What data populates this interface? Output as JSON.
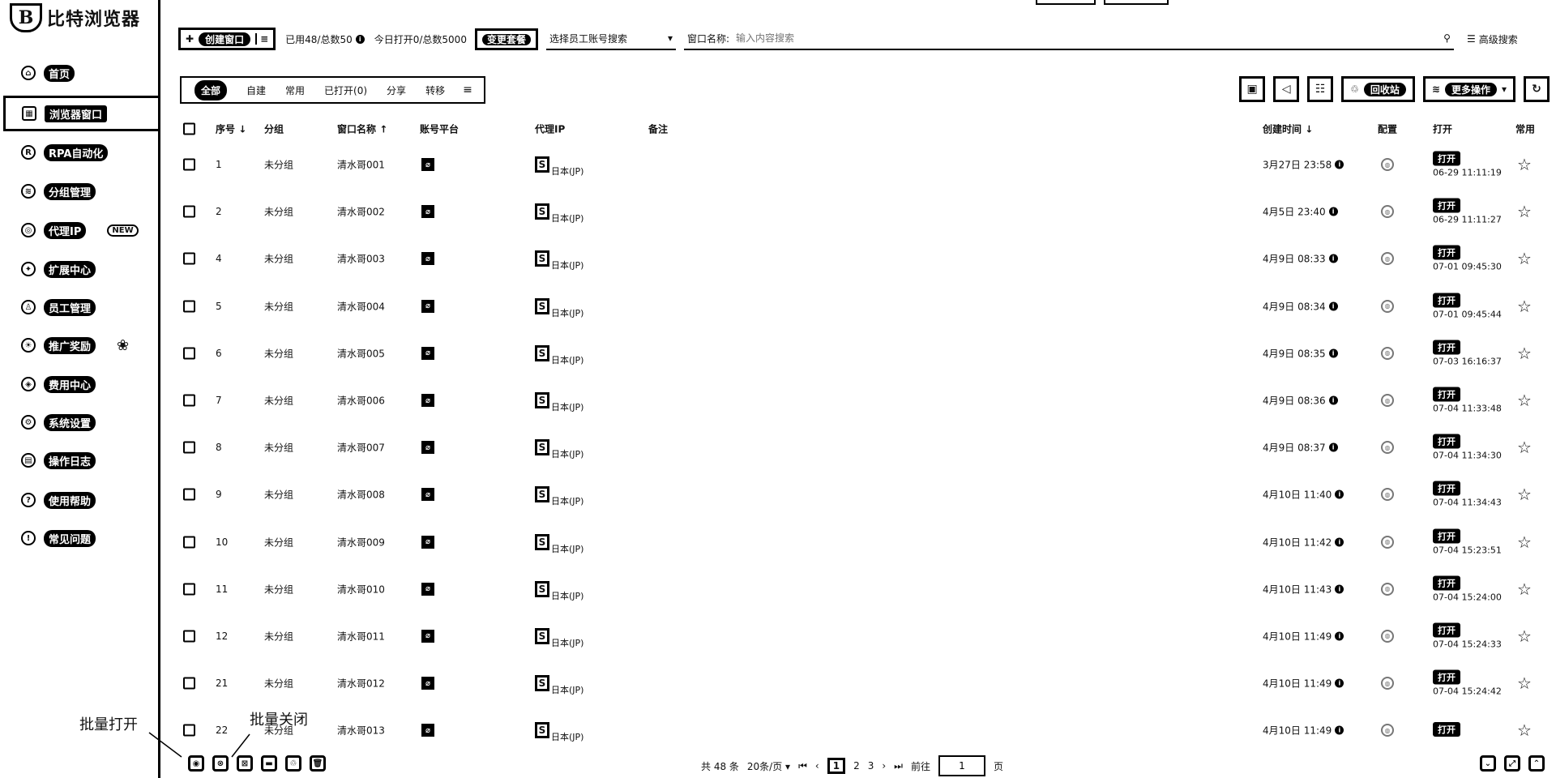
{
  "app": {
    "logo_mark": "B",
    "name": "比特浏览器"
  },
  "sidebar": {
    "items": [
      {
        "label": "首页",
        "icon": "home-icon",
        "glyph": "⌂"
      },
      {
        "label": "浏览器窗口",
        "icon": "window-grid-icon",
        "glyph": "▦"
      },
      {
        "label": "RPA自动化",
        "icon": "robot-icon",
        "glyph": "R"
      },
      {
        "label": "分组管理",
        "icon": "layers-icon",
        "glyph": "≋"
      },
      {
        "label": "代理IP",
        "icon": "location-pin-icon",
        "glyph": "◎",
        "badge": "NEW"
      },
      {
        "label": "扩展中心",
        "icon": "puzzle-icon",
        "glyph": "✦"
      },
      {
        "label": "员工管理",
        "icon": "users-icon",
        "glyph": "♙"
      },
      {
        "label": "推广奖励",
        "icon": "bulb-icon",
        "glyph": "☀",
        "extra_icon": "gift-icon"
      },
      {
        "label": "费用中心",
        "icon": "shield-icon",
        "glyph": "◈"
      },
      {
        "label": "系统设置",
        "icon": "gear-icon",
        "glyph": "⚙"
      },
      {
        "label": "操作日志",
        "icon": "log-icon",
        "glyph": "▤"
      },
      {
        "label": "使用帮助",
        "icon": "help-icon",
        "glyph": "?"
      },
      {
        "label": "常见问题",
        "icon": "info-icon",
        "glyph": "!"
      }
    ]
  },
  "toolbar": {
    "create_label": "创建窗口",
    "quota_used": "已用48/总数50",
    "quota_open": "今日打开0/总数5000",
    "change_plan": "变更套餐",
    "staff_placeholder": "选择员工账号搜索",
    "window_name_label": "窗口名称:",
    "window_name_placeholder": "输入内容搜索",
    "advanced_search": "高级搜索"
  },
  "filter_tabs": [
    "全部",
    "自建",
    "常用",
    "已打开(0)",
    "分享",
    "转移"
  ],
  "actions": {
    "recycle": "回收站",
    "more": "更多操作"
  },
  "table": {
    "headers": {
      "index": "序号",
      "group": "分组",
      "name": "窗口名称",
      "platform": "账号平台",
      "proxy": "代理IP",
      "remark": "备注",
      "created": "创建时间",
      "config": "配置",
      "open": "打开",
      "fav": "常用"
    },
    "open_label": "打开",
    "rows": [
      {
        "idx": "1",
        "group": "未分组",
        "name": "清水哥001",
        "proxy": "日本(JP)",
        "created": "3月27日 23:58",
        "opened": "06-29 11:11:19"
      },
      {
        "idx": "2",
        "group": "未分组",
        "name": "清水哥002",
        "proxy": "日本(JP)",
        "created": "4月5日 23:40",
        "opened": "06-29 11:11:27"
      },
      {
        "idx": "4",
        "group": "未分组",
        "name": "清水哥003",
        "proxy": "日本(JP)",
        "created": "4月9日 08:33",
        "opened": "07-01 09:45:30"
      },
      {
        "idx": "5",
        "group": "未分组",
        "name": "清水哥004",
        "proxy": "日本(JP)",
        "created": "4月9日 08:34",
        "opened": "07-01 09:45:44"
      },
      {
        "idx": "6",
        "group": "未分组",
        "name": "清水哥005",
        "proxy": "日本(JP)",
        "created": "4月9日 08:35",
        "opened": "07-03 16:16:37"
      },
      {
        "idx": "7",
        "group": "未分组",
        "name": "清水哥006",
        "proxy": "日本(JP)",
        "created": "4月9日 08:36",
        "opened": "07-04 11:33:48"
      },
      {
        "idx": "8",
        "group": "未分组",
        "name": "清水哥007",
        "proxy": "日本(JP)",
        "created": "4月9日 08:37",
        "opened": "07-04 11:34:30"
      },
      {
        "idx": "9",
        "group": "未分组",
        "name": "清水哥008",
        "proxy": "日本(JP)",
        "created": "4月10日 11:40",
        "opened": "07-04 11:34:43"
      },
      {
        "idx": "10",
        "group": "未分组",
        "name": "清水哥009",
        "proxy": "日本(JP)",
        "created": "4月10日 11:42",
        "opened": "07-04 15:23:51"
      },
      {
        "idx": "11",
        "group": "未分组",
        "name": "清水哥010",
        "proxy": "日本(JP)",
        "created": "4月10日 11:43",
        "opened": "07-04 15:24:00"
      },
      {
        "idx": "12",
        "group": "未分组",
        "name": "清水哥011",
        "proxy": "日本(JP)",
        "created": "4月10日 11:49",
        "opened": "07-04 15:24:33"
      },
      {
        "idx": "21",
        "group": "未分组",
        "name": "清水哥012",
        "proxy": "日本(JP)",
        "created": "4月10日 11:49",
        "opened": "07-04 15:24:42"
      },
      {
        "idx": "22",
        "group": "未分组",
        "name": "清水哥013",
        "proxy": "日本(JP)",
        "created": "4月10日 11:49",
        "opened": ""
      }
    ]
  },
  "bottom": {
    "annotation_open": "批量打开",
    "annotation_close": "批量关闭",
    "total": "共 48 条",
    "page_size": "20条/页",
    "pages": [
      "1",
      "2",
      "3"
    ],
    "goto_label": "前往",
    "goto_value": "1",
    "page_suffix": "页"
  }
}
